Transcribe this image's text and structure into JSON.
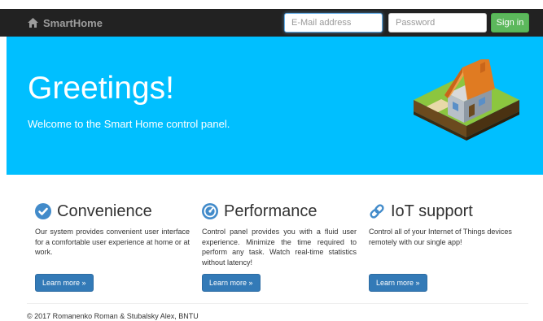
{
  "navbar": {
    "brand": "SmartHome",
    "brand_icon": "home-icon",
    "email_placeholder": "E-Mail address",
    "password_placeholder": "Password",
    "signin_label": "Sign in"
  },
  "hero": {
    "title": "Greetings!",
    "subtitle": "Welcome to the Smart Home control panel.",
    "background": "#00bfff"
  },
  "features": [
    {
      "title": "Convenience",
      "icon": "check-circle-icon",
      "text": "Our system provides convenient user interface for a comfortable user experience at home or at work.",
      "button": "Learn more »"
    },
    {
      "title": "Performance",
      "icon": "dashboard-icon",
      "text": "Control panel provides you with a fluid user experience. Minimize the time required to perform any task. Watch real-time statistics without latency!",
      "button": "Learn more »"
    },
    {
      "title": "IoT support",
      "icon": "link-icon",
      "text": "Control all of your Internet of Things devices remotely with our single app!",
      "button": "Learn more »"
    }
  ],
  "footer": {
    "text": "© 2017 Romanenko Roman & Stubalsky Alex, BNTU"
  },
  "colors": {
    "navbar": "#222222",
    "primary": "#337ab7",
    "success": "#5cb85c",
    "icon_blue": "#428bca"
  }
}
